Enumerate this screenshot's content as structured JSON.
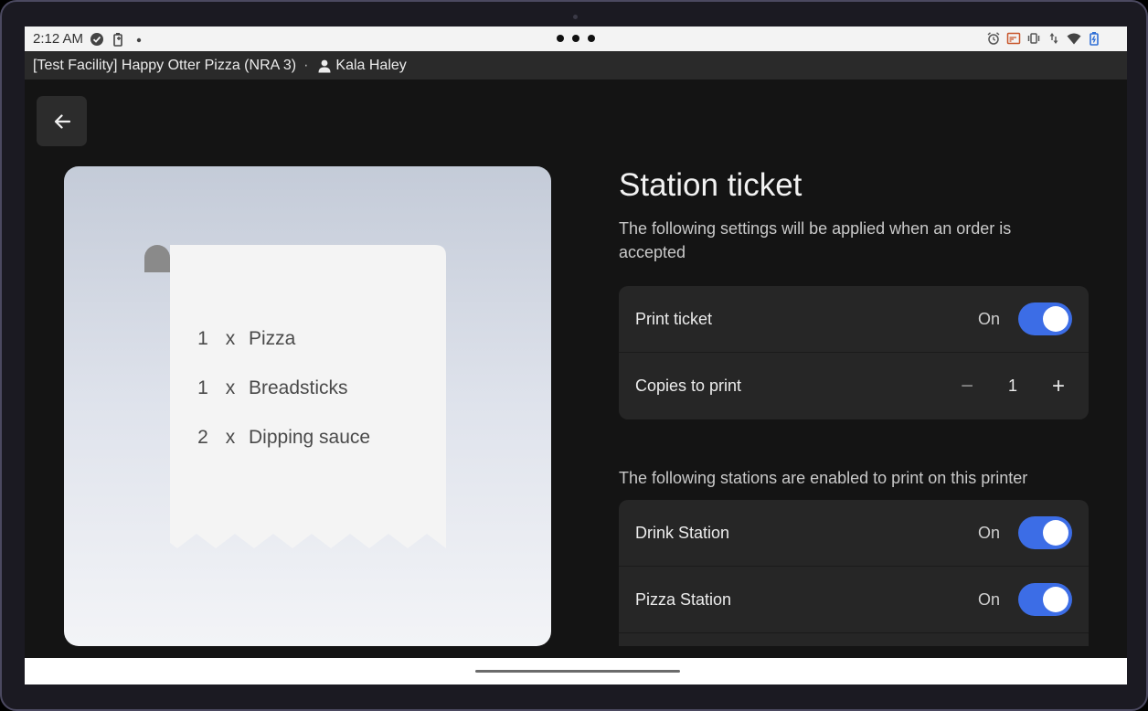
{
  "status_bar": {
    "time": "2:12 AM",
    "left_icons": [
      "check-circle-icon",
      "battery-saver-icon",
      "dot-icon"
    ],
    "right_icons": [
      "alarm-icon",
      "cast-icon",
      "vibrate-icon",
      "data-arrows-icon",
      "wifi-icon",
      "battery-icon"
    ]
  },
  "header": {
    "facility": "[Test Facility] Happy Otter Pizza (NRA 3)",
    "separator": "·",
    "user_name": "Kala Haley"
  },
  "back_button": {
    "icon": "arrow-left-icon"
  },
  "ticket_preview": {
    "lines": [
      {
        "qty": "1",
        "x": "x",
        "item": "Pizza"
      },
      {
        "qty": "1",
        "x": "x",
        "item": "Breadsticks"
      },
      {
        "qty": "2",
        "x": "x",
        "item": "Dipping sauce"
      }
    ]
  },
  "main": {
    "title": "Station ticket",
    "subtitle": "The following settings will be applied when an order is accepted",
    "print_ticket": {
      "label": "Print ticket",
      "state": "On"
    },
    "copies": {
      "label": "Copies to print",
      "minus": "−",
      "value": "1",
      "plus": "+"
    },
    "stations_label": "The following stations are enabled to print on this printer",
    "stations": [
      {
        "label": "Drink Station",
        "state": "On"
      },
      {
        "label": "Pizza Station",
        "state": "On"
      }
    ]
  },
  "colors": {
    "accent": "#3c6de6",
    "background": "#141414",
    "card": "#262626"
  }
}
